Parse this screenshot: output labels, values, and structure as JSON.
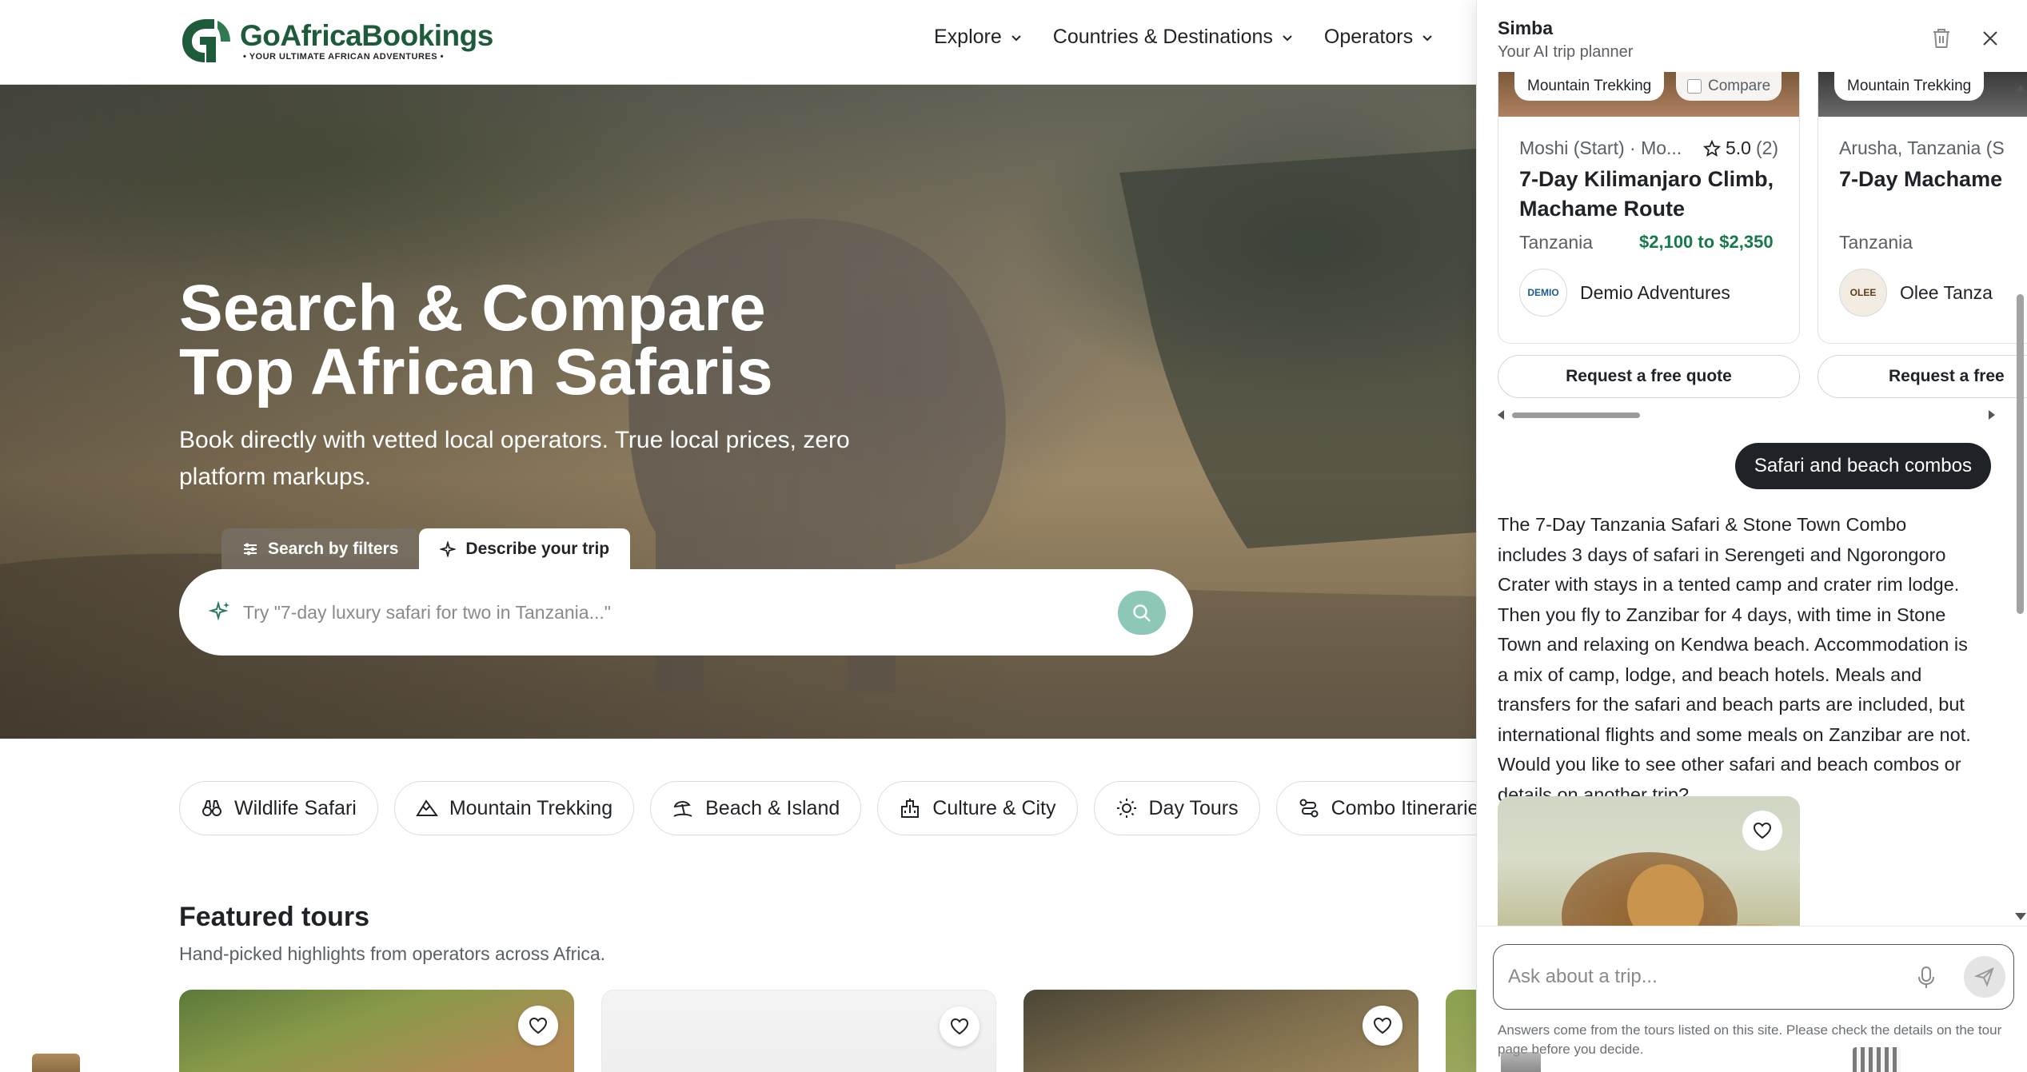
{
  "brand": {
    "name": "GoAfricaBookings",
    "tagline": "• YOUR ULTIMATE AFRICAN ADVENTURES •",
    "color": "#1d5b3a"
  },
  "nav": {
    "items": [
      {
        "label": "Explore"
      },
      {
        "label": "Countries & Destinations"
      },
      {
        "label": "Operators"
      }
    ]
  },
  "hero": {
    "title": "Search & Compare Top African Safaris",
    "subtitle": "Book directly with vetted local operators. True local prices, zero platform markups.",
    "tab_filters": "Search by filters",
    "tab_describe": "Describe your trip",
    "search_placeholder": "Try \"7-day luxury safari for two in Tanzania...\""
  },
  "categories": [
    {
      "label": "Wildlife Safari",
      "icon": "binoculars-icon"
    },
    {
      "label": "Mountain Trekking",
      "icon": "mountain-icon"
    },
    {
      "label": "Beach & Island",
      "icon": "beach-icon"
    },
    {
      "label": "Culture & City",
      "icon": "building-icon"
    },
    {
      "label": "Day Tours",
      "icon": "sun-icon"
    },
    {
      "label": "Combo Itineraries",
      "icon": "route-icon"
    }
  ],
  "featured": {
    "title": "Featured tours",
    "subtitle": "Hand-picked highlights from operators across Africa."
  },
  "chat": {
    "assistant_name": "Simba",
    "assistant_role": "Your AI trip planner",
    "tours": [
      {
        "category": "Mountain Trekking",
        "compare_label": "Compare",
        "location": "Moshi (Start) · Mo...",
        "rating": "5.0",
        "rating_count": "(2)",
        "title": "7-Day Kilimanjaro Climb, Machame Route",
        "country": "Tanzania",
        "price": "$2,100 to $2,350",
        "operator": "Demio Adventures",
        "operator_logo_text": "DEMIO",
        "cta": "Request a free quote"
      },
      {
        "category": "Mountain Trekking",
        "location": "Arusha, Tanzania (S",
        "title": "7-Day Machame",
        "country": "Tanzania",
        "operator": "Olee Tanza",
        "operator_logo_text": "OLEE",
        "cta": "Request a free"
      }
    ],
    "user_message": "Safari and beach combos",
    "assistant_answer": "The 7-Day Tanzania Safari & Stone Town Combo includes 3 days of safari in Serengeti and Ngorongoro Crater with stays in a tented camp and crater rim lodge. Then you fly to Zanzibar for 4 days, with time in Stone Town and relaxing on Kendwa beach. Accommodation is a mix of camp, lodge, and beach hotels. Meals and transfers for the safari and beach parts are included, but international flights and some meals on Zanzibar are not. Would you like to see other safari and beach combos or details on another trip?",
    "input_placeholder": "Ask about a trip...",
    "disclaimer": "Answers come from the tours listed on this site. Please check the details on the tour page before you decide.",
    "price_color": "#157a4a"
  }
}
